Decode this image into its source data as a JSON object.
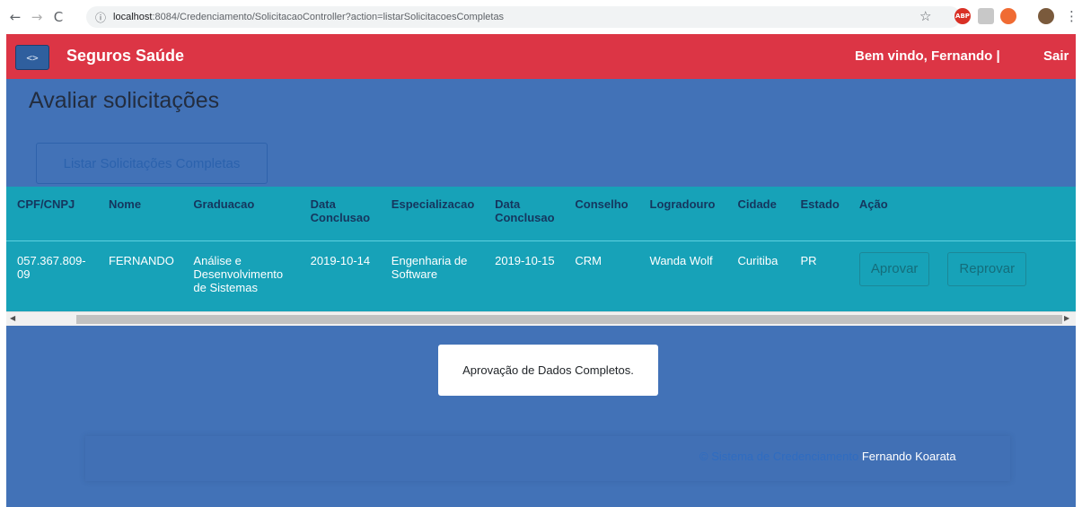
{
  "browser": {
    "url_host": "localhost",
    "url_path": ":8084/Credenciamento/SolicitacaoController?action=listarSolicitacoesCompletas",
    "extensions": [
      {
        "name": "abp-icon",
        "label": "ABP",
        "color": "#d93025"
      },
      {
        "name": "extension-icon",
        "label": "",
        "color": "#c8c8c8"
      },
      {
        "name": "extension-orange-icon",
        "label": "",
        "color": "#f06b33"
      },
      {
        "name": "profile-avatar-icon",
        "label": "",
        "color": "#7a5a3c"
      }
    ]
  },
  "navbar": {
    "toggle_label": "<>",
    "brand": "Seguros Saúde",
    "welcome": "Bem vindo, Fernando |",
    "logout": "Sair"
  },
  "page": {
    "title": "Avaliar solicitações",
    "list_button": "Listar Solicitações Completas"
  },
  "table": {
    "headers": [
      "CPF/CNPJ",
      "Nome",
      "Graduacao",
      "Data Conclusao",
      "Especializacao",
      "Data Conclusao",
      "Conselho",
      "Logradouro",
      "Cidade",
      "Estado",
      "Ação"
    ],
    "rows": [
      {
        "cpf": "057.367.809-09",
        "nome": "FERNANDO",
        "graduacao": "Análise e Desenvolvimento de Sistemas",
        "data_conclusao_grad": "2019-10-14",
        "especializacao": "Engenharia de Software",
        "data_conclusao_esp": "2019-10-15",
        "conselho": "CRM",
        "logradouro": "Wanda Wolf",
        "cidade": "Curitiba",
        "estado": "PR",
        "approve_label": "Aprovar",
        "reject_label": "Reprovar"
      }
    ]
  },
  "toast": {
    "message": "Aprovação de Dados Completos."
  },
  "footer": {
    "credit": "© Sistema de Credenciamento",
    "author": "Fernando Koarata"
  },
  "colors": {
    "navbar": "#dc3545",
    "background": "#4272b7",
    "table": "#17a2b8"
  }
}
